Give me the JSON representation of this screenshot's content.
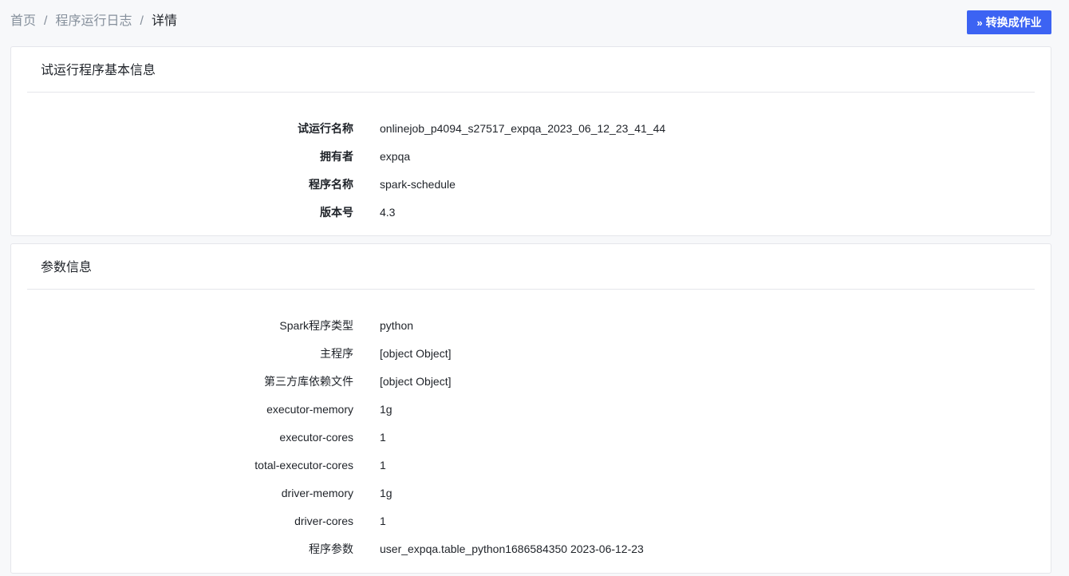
{
  "breadcrumb": {
    "home": "首页",
    "logs": "程序运行日志",
    "current": "详情",
    "separator": "/"
  },
  "toolbar": {
    "convert_icon": "»",
    "convert_label": "转换成作业"
  },
  "basic_info": {
    "title": "试运行程序基本信息",
    "rows": [
      {
        "label": "试运行名称",
        "value": "onlinejob_p4094_s27517_expqa_2023_06_12_23_41_44"
      },
      {
        "label": "拥有者",
        "value": "expqa"
      },
      {
        "label": "程序名称",
        "value": "spark-schedule"
      },
      {
        "label": "版本号",
        "value": "4.3"
      }
    ]
  },
  "params_info": {
    "title": "参数信息",
    "rows": [
      {
        "label": "Spark程序类型",
        "value": "python"
      },
      {
        "label": "主程序",
        "value": "[object Object]"
      },
      {
        "label": "第三方库依赖文件",
        "value": "[object Object]"
      },
      {
        "label": "executor-memory",
        "value": "1g"
      },
      {
        "label": "executor-cores",
        "value": "1"
      },
      {
        "label": "total-executor-cores",
        "value": "1"
      },
      {
        "label": "driver-memory",
        "value": "1g"
      },
      {
        "label": "driver-cores",
        "value": "1"
      },
      {
        "label": "程序参数",
        "value": "user_expqa.table_python1686584350 2023-06-12-23"
      }
    ]
  },
  "colors": {
    "primary": "#3c63f3",
    "text": "#1f2329",
    "muted": "#86909c",
    "border": "#e5e6eb"
  }
}
